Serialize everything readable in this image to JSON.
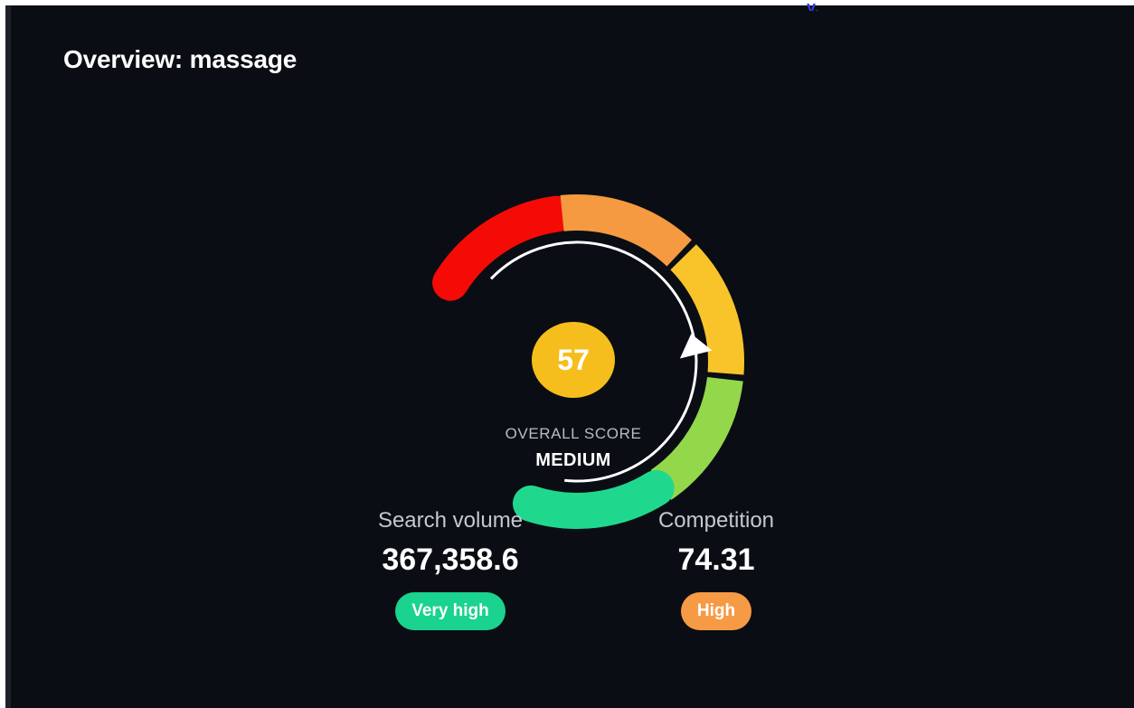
{
  "header": {
    "title": "Overview: massage"
  },
  "gauge": {
    "score": "57",
    "score_label": "OVERALL SCORE",
    "level": "MEDIUM",
    "score_fraction": 0.57,
    "colors": {
      "segment_1": "#f40b06",
      "segment_2": "#f59a40",
      "segment_3": "#f8c42a",
      "segment_4": "#93d84a",
      "segment_5": "#1fd88e",
      "badge": "#f6be1c"
    }
  },
  "metrics": {
    "search_volume": {
      "label": "Search volume",
      "value": "367,358.6",
      "badge": "Very high",
      "badge_color": "#19d38e"
    },
    "competition": {
      "label": "Competition",
      "value": "74.31",
      "badge": "High",
      "badge_color": "#f79a45"
    }
  }
}
